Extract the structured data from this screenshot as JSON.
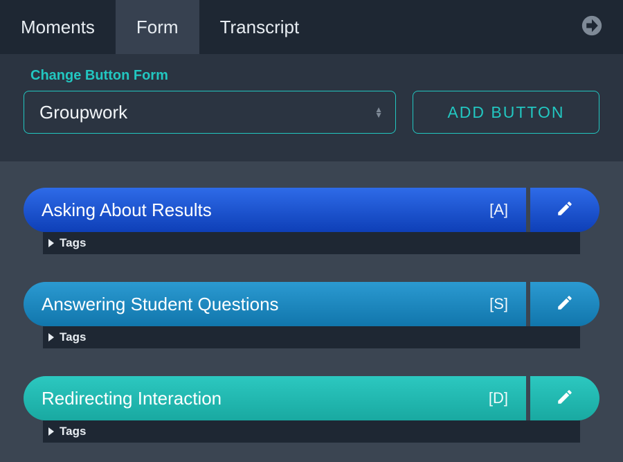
{
  "header": {
    "tabs": [
      {
        "label": "Moments",
        "active": false
      },
      {
        "label": "Form",
        "active": true
      },
      {
        "label": "Transcript",
        "active": false
      }
    ]
  },
  "formpanel": {
    "label": "Change Button Form",
    "select_value": "Groupwork",
    "add_button_label": "ADD BUTTON"
  },
  "items": [
    {
      "label": "Asking About Results",
      "shortcut": "[A]",
      "tags_label": "Tags",
      "gradient": "grad-blue"
    },
    {
      "label": "Answering Student Questions",
      "shortcut": "[S]",
      "tags_label": "Tags",
      "gradient": "grad-blue2"
    },
    {
      "label": "Redirecting Interaction",
      "shortcut": "[D]",
      "tags_label": "Tags",
      "gradient": "grad-teal"
    }
  ]
}
